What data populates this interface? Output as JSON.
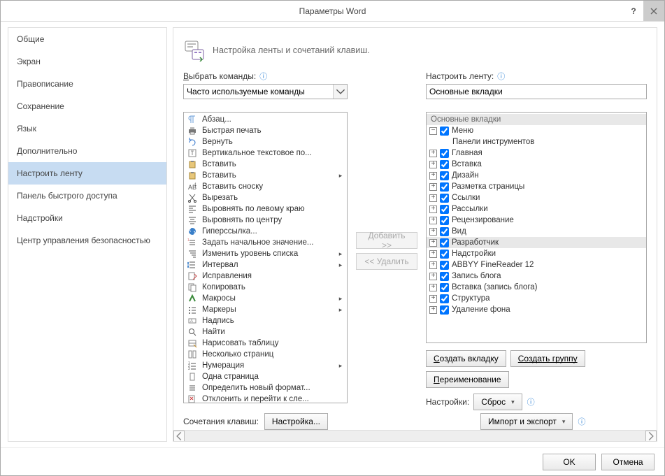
{
  "window": {
    "title": "Параметры Word"
  },
  "sidebar": {
    "items": [
      {
        "label": "Общие"
      },
      {
        "label": "Экран"
      },
      {
        "label": "Правописание"
      },
      {
        "label": "Сохранение"
      },
      {
        "label": "Язык"
      },
      {
        "label": "Дополнительно"
      },
      {
        "label": "Настроить ленту"
      },
      {
        "label": "Панель быстрого доступа"
      },
      {
        "label": "Надстройки"
      },
      {
        "label": "Центр управления безопасностью"
      }
    ],
    "active_index": 6
  },
  "header": {
    "text": "Настройка ленты и сочетаний клавиш."
  },
  "left": {
    "label": "Выбрать команды:",
    "combo_value": "Часто используемые команды",
    "commands": [
      {
        "label": "Абзац...",
        "icon": "paragraph"
      },
      {
        "label": "Быстрая печать",
        "icon": "printer"
      },
      {
        "label": "Вернуть",
        "icon": "redo"
      },
      {
        "label": "Вертикальное текстовое по...",
        "icon": "textbox"
      },
      {
        "label": "Вставить",
        "icon": "paste"
      },
      {
        "label": "Вставить",
        "icon": "paste",
        "arrow": true
      },
      {
        "label": "Вставить сноску",
        "icon": "footnote"
      },
      {
        "label": "Вырезать",
        "icon": "cut"
      },
      {
        "label": "Выровнять по левому краю",
        "icon": "align-left"
      },
      {
        "label": "Выровнять по центру",
        "icon": "align-center"
      },
      {
        "label": "Гиперссылка...",
        "icon": "link"
      },
      {
        "label": "Задать начальное значение...",
        "icon": "list-start"
      },
      {
        "label": "Изменить уровень списка",
        "icon": "list-level",
        "arrow": true
      },
      {
        "label": "Интервал",
        "icon": "spacing",
        "arrow": true
      },
      {
        "label": "Исправления",
        "icon": "track"
      },
      {
        "label": "Копировать",
        "icon": "copy"
      },
      {
        "label": "Макросы",
        "icon": "macro",
        "arrow": true
      },
      {
        "label": "Маркеры",
        "icon": "bullets",
        "arrow": true
      },
      {
        "label": "Надпись",
        "icon": "label"
      },
      {
        "label": "Найти",
        "icon": "find"
      },
      {
        "label": "Нарисовать таблицу",
        "icon": "draw-table"
      },
      {
        "label": "Несколько страниц",
        "icon": "pages"
      },
      {
        "label": "Нумерация",
        "icon": "numbering",
        "arrow": true
      },
      {
        "label": "Одна страница",
        "icon": "one-page"
      },
      {
        "label": "Определить новый формат...",
        "icon": "format"
      },
      {
        "label": "Отклонить и перейти к сле...",
        "icon": "reject"
      }
    ]
  },
  "mid": {
    "add_label": "Добавить >>",
    "remove_label": "<< Удалить"
  },
  "right": {
    "label": "Настроить ленту:",
    "combo_value": "Основные вкладки",
    "tree_header": "Основные вкладки",
    "nodes": [
      {
        "label": "Меню",
        "exp": "-",
        "checked": true
      },
      {
        "label": "Панели инструментов",
        "child": true,
        "exp": "+"
      },
      {
        "label": "Главная",
        "exp": "+",
        "checked": true
      },
      {
        "label": "Вставка",
        "exp": "+",
        "checked": true
      },
      {
        "label": "Дизайн",
        "exp": "+",
        "checked": true
      },
      {
        "label": "Разметка страницы",
        "exp": "+",
        "checked": true
      },
      {
        "label": "Ссылки",
        "exp": "+",
        "checked": true
      },
      {
        "label": "Рассылки",
        "exp": "+",
        "checked": true
      },
      {
        "label": "Рецензирование",
        "exp": "+",
        "checked": true
      },
      {
        "label": "Вид",
        "exp": "+",
        "checked": true
      },
      {
        "label": "Разработчик",
        "exp": "+",
        "checked": true,
        "highlight": true
      },
      {
        "label": "Надстройки",
        "exp": "+",
        "checked": true
      },
      {
        "label": "ABBYY FineReader 12",
        "exp": "+",
        "checked": true
      },
      {
        "label": "Запись блога",
        "exp": "+",
        "checked": true
      },
      {
        "label": "Вставка (запись блога)",
        "exp": "+",
        "checked": true
      },
      {
        "label": "Структура",
        "exp": "+",
        "checked": true
      },
      {
        "label": "Удаление фона",
        "exp": "+",
        "checked": true
      }
    ],
    "new_tab": "Создать вкладку",
    "new_group": "Создать группу",
    "rename": "Переименование",
    "settings_label": "Настройки:",
    "reset": "Сброс",
    "import_export": "Импорт и экспорт"
  },
  "hotkeys": {
    "label": "Сочетания клавиш:",
    "button": "Настройка..."
  },
  "footer": {
    "ok": "OK",
    "cancel": "Отмена"
  }
}
